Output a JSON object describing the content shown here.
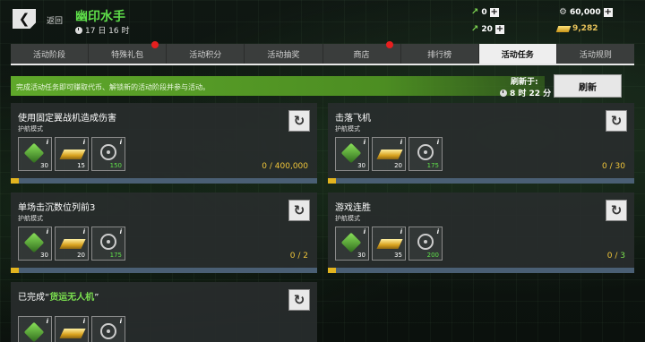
{
  "header": {
    "back_label": "返回",
    "title": "幽印水手",
    "date": "17 日 16 时",
    "resources": {
      "darts": "0",
      "darts2": "20",
      "gears": "60,000",
      "gold": "9,282"
    }
  },
  "tabs": [
    {
      "label": "活动阶段",
      "active": false,
      "dot": false
    },
    {
      "label": "特殊礼包",
      "active": false,
      "dot": true
    },
    {
      "label": "活动积分",
      "active": false,
      "dot": false
    },
    {
      "label": "活动抽奖",
      "active": false,
      "dot": false
    },
    {
      "label": "商店",
      "active": false,
      "dot": true
    },
    {
      "label": "排行榜",
      "active": false,
      "dot": false
    },
    {
      "label": "活动任务",
      "active": true,
      "dot": false
    },
    {
      "label": "活动规则",
      "active": false,
      "dot": false
    }
  ],
  "info": {
    "text": "完成活动任务即可赚取代币、解锁新的活动阶段并参与活动。",
    "refresh_label": "刷新于:",
    "refresh_time": "8 时 22 分",
    "refresh_button": "刷新"
  },
  "missions": [
    {
      "title": "使用固定翼战机造成伤害",
      "mode": "护航模式",
      "rewards": [
        "30",
        "15",
        "150"
      ],
      "current": "0",
      "goal": "400,000",
      "progress": 0.01
    },
    {
      "title": "击落飞机",
      "mode": "护航模式",
      "rewards": [
        "30",
        "20",
        "175"
      ],
      "current": "0",
      "goal": "30",
      "progress": 0.01
    },
    {
      "title": "单场击沉数位列前3",
      "mode": "护航模式",
      "rewards": [
        "30",
        "20",
        "175"
      ],
      "current": "0",
      "goal": "2",
      "progress": 0.01
    },
    {
      "title": "游戏连胜",
      "mode": "护航模式",
      "rewards": [
        "30",
        "35",
        "200"
      ],
      "current": "0",
      "goal": "3",
      "progress": 0.01
    },
    {
      "title_prefix": "已完成“",
      "title_highlight": "货运无人机",
      "title_suffix": "”"
    }
  ],
  "colors": {
    "accent_green": "#5fe04a",
    "progress_yellow": "#e2b41f",
    "badge_red": "#e61f1f"
  }
}
